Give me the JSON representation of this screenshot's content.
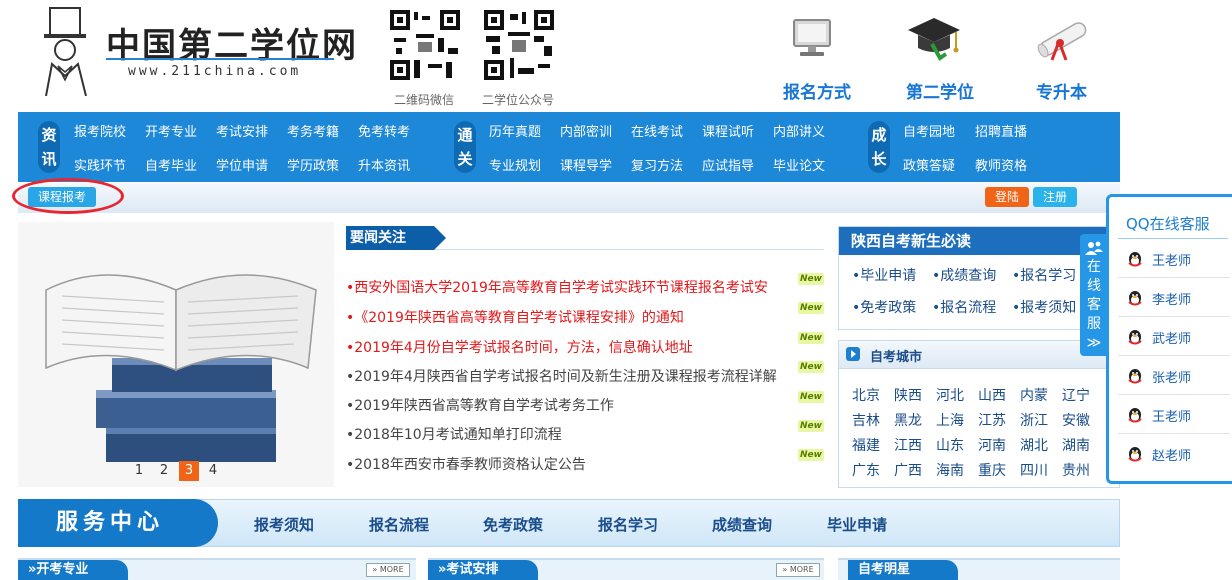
{
  "header": {
    "site_title": "中国第二学位网",
    "site_url": "www.211china.com",
    "qr_wechat_caption": "二维码微信",
    "qr_public_caption": "二学位公众号",
    "top_links": [
      "报名方式",
      "第二学位",
      "专升本"
    ]
  },
  "nav": {
    "group1_label": "资讯",
    "group1_row1": [
      "报考院校",
      "开考专业",
      "考试安排",
      "考务考籍",
      "免考转考"
    ],
    "group1_row2": [
      "实践环节",
      "自考毕业",
      "学位申请",
      "学历政策",
      "升本资讯"
    ],
    "group2_label": "通关",
    "group2_row1": [
      "历年真题",
      "内部密训",
      "在线考试",
      "课程试听",
      "内部讲义"
    ],
    "group2_row2": [
      "专业规划",
      "课程导学",
      "复习方法",
      "应试指导",
      "毕业论文"
    ],
    "group3_label": "成长",
    "group3_row1": [
      "自考园地",
      "招聘直播"
    ],
    "group3_row2": [
      "政策答疑",
      "教师资格"
    ]
  },
  "strip": {
    "course_btn": "课程报考",
    "login_btn": "登陆",
    "register_btn": "注册"
  },
  "slider": {
    "pages": [
      "1",
      "2",
      "3",
      "4"
    ],
    "active_page": "3"
  },
  "news": {
    "title": "要闻关注",
    "new_badge": "New",
    "items": [
      {
        "text": "•西安外国语大学2019年高等教育自学考试实践环节课程报名考试安",
        "color": "red"
      },
      {
        "text": "•《2019年陕西省高等教育自学考试课程安排》的通知",
        "color": "red"
      },
      {
        "text": "•2019年4月份自学考试报名时间，方法，信息确认地址",
        "color": "red"
      },
      {
        "text": "•2019年4月陕西省自学考试报名时间及新生注册及课程报考流程详解",
        "color": "gray"
      },
      {
        "text": "•2019年陕西省高等教育自学考试考务工作",
        "color": "gray"
      },
      {
        "text": "•2018年10月考试通知单打印流程",
        "color": "gray"
      },
      {
        "text": "•2018年西安市春季教师资格认定公告",
        "color": "gray"
      }
    ]
  },
  "newbie": {
    "title": "陕西自考新生必读",
    "row1": [
      "•毕业申请",
      "•成绩查询",
      "•报名学习"
    ],
    "row2": [
      "•免考政策",
      "•报名流程",
      "•报考须知"
    ]
  },
  "cities": {
    "title": "自考城市",
    "rows": [
      [
        "北京",
        "陕西",
        "河北",
        "山西",
        "内蒙",
        "辽宁"
      ],
      [
        "吉林",
        "黑龙",
        "上海",
        "江苏",
        "浙江",
        "安徽"
      ],
      [
        "福建",
        "江西",
        "山东",
        "河南",
        "湖北",
        "湖南"
      ],
      [
        "广东",
        "广西",
        "海南",
        "重庆",
        "四川",
        "贵州"
      ]
    ]
  },
  "qq": {
    "title": "QQ在线客服",
    "tab_text": [
      "在",
      "线",
      "客",
      "服",
      "≫"
    ],
    "staff": [
      "王老师",
      "李老师",
      "武老师",
      "张老师",
      "王老师",
      "赵老师"
    ]
  },
  "service": {
    "label": "服务中心",
    "links": [
      "报考须知",
      "报名流程",
      "免考政策",
      "报名学习",
      "成绩查询",
      "毕业申请"
    ]
  },
  "bottom": {
    "sec1": "»开考专业",
    "sec2": "»考试安排",
    "sec3": "自考明星",
    "more": "» MORE"
  },
  "colors": {
    "nav_blue": "#1d88d8",
    "accent_red": "#e0191b",
    "orange": "#f06418"
  }
}
